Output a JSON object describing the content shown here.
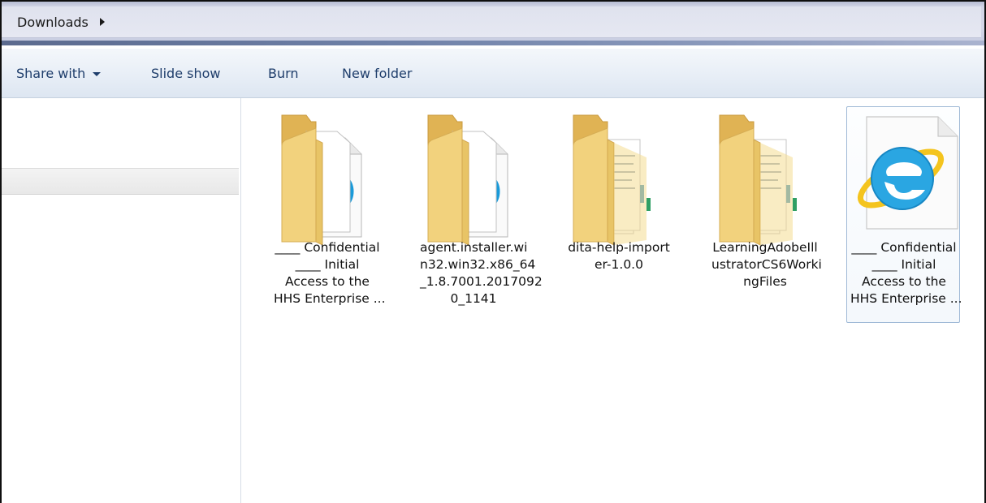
{
  "address": {
    "crumb": "Downloads"
  },
  "toolbar": {
    "share_with": "Share with",
    "slide_show": "Slide show",
    "burn": "Burn",
    "new_folder": "New folder"
  },
  "files": [
    {
      "name_lines": [
        "____ Confidential",
        "____ Initial",
        "Access to the",
        "HHS Enterprise ..."
      ],
      "type": "folder-with-ie-doc",
      "selected": false
    },
    {
      "name_lines": [
        "agent.installer.wi",
        "n32.win32.x86_64",
        "_1.8.7001.2017092",
        "0_1141"
      ],
      "type": "folder-with-ie-doc",
      "selected": false
    },
    {
      "name_lines": [
        "dita-help-import",
        "er-1.0.0"
      ],
      "type": "folder-with-docs",
      "selected": false
    },
    {
      "name_lines": [
        "LearningAdobeIll",
        "ustratorCS6Worki",
        "ngFiles"
      ],
      "type": "folder-with-docs",
      "selected": false
    },
    {
      "name_lines": [
        "____ Confidential",
        "____ Initial",
        "Access to the",
        "HHS Enterprise ..."
      ],
      "type": "ie-html-file",
      "selected": true
    }
  ],
  "colors": {
    "folder_front": "#f2d27d",
    "folder_back": "#e2b656",
    "ie_blue": "#1a9ad9",
    "ie_ring": "#f4c41e",
    "toolbar_text": "#1e3d6b",
    "selection_border": "#9fb9d6"
  }
}
